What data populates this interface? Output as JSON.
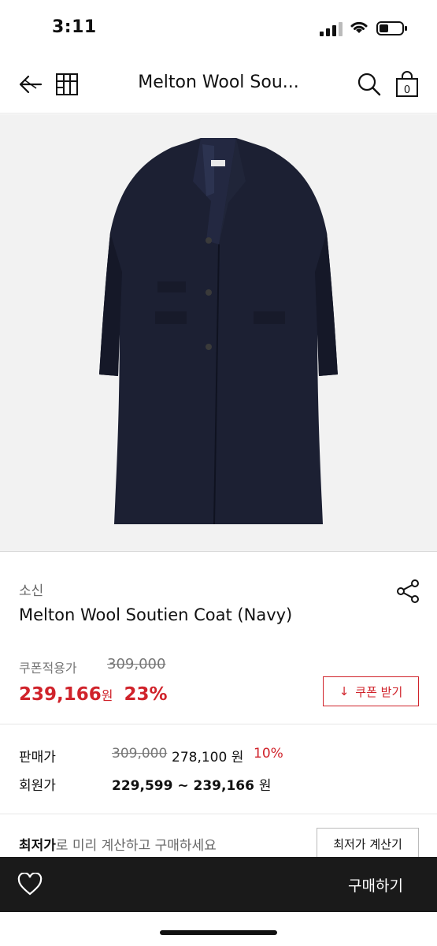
{
  "status_bar": {
    "time": "3:11"
  },
  "nav": {
    "title": "Melton Wool Sou...",
    "cart_count": "0"
  },
  "product": {
    "brand": "소신",
    "name": "Melton Wool Soutien Coat (Navy)",
    "image_icon": "coat-photo",
    "accent_color": "#d0232b"
  },
  "coupon": {
    "label": "쿠폰적용가",
    "original_price": "309,000",
    "price": "239,166",
    "won": "원",
    "discount": "23%",
    "button_label": "쿠폰 받기",
    "button_icon": "↓"
  },
  "sale": {
    "label": "판매가",
    "original_price": "309,000",
    "price": "278,100 원",
    "discount": "10%"
  },
  "member": {
    "label": "회원가",
    "range": "229,599 ~ 239,166",
    "won": "원"
  },
  "lowest": {
    "bold": "최저가",
    "rest": "로 미리 계산하고 구매하세요",
    "button_label": "최저가 계산기"
  },
  "bottom": {
    "buy_label": "구매하기"
  }
}
